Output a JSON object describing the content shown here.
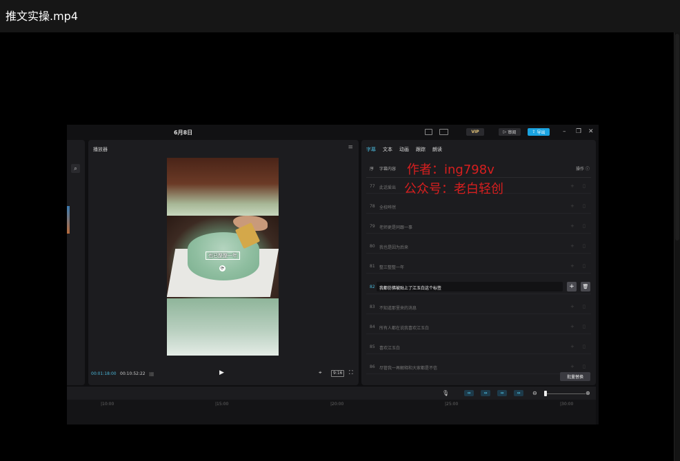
{
  "top_bar": {
    "title": "推文实操.mp4"
  },
  "app": {
    "date": "6月8日",
    "vip_label": "VIP",
    "publish_label": "审阅",
    "export_label": "导出",
    "window_controls": {
      "minimize": "–",
      "maximize": "❐",
      "close": "✕"
    }
  },
  "player": {
    "title": "播放器",
    "menu_icon": "≡",
    "current_time": "00:01:18:00",
    "total_time": "00:10:52:22",
    "ratio_label": "9:16",
    "subtitle_overlay": "也已整整一年",
    "play_icon": "▶"
  },
  "subtitle_panel": {
    "tabs": [
      "字幕",
      "文本",
      "动画",
      "跟踪",
      "朗读"
    ],
    "active_tab": 0,
    "col_index": "序",
    "col_content": "字幕内容",
    "col_actions": "操作 ⓘ",
    "watermark_line1": "作者：ing798v",
    "watermark_line2": "公众号：老白轻创",
    "rows": [
      {
        "num": "77",
        "text": "此话爱出"
      },
      {
        "num": "78",
        "text": "全校哗然"
      },
      {
        "num": "79",
        "text": "老师更是同跟一事"
      },
      {
        "num": "80",
        "text": "我也是因为后来"
      },
      {
        "num": "81",
        "text": "整三整整一年"
      },
      {
        "num": "82",
        "text": "我都仿佛被贴上了江玉白这个标签"
      },
      {
        "num": "83",
        "text": "不知道那里来的消息"
      },
      {
        "num": "84",
        "text": "所有人都在说我喜欢江玉白"
      },
      {
        "num": "85",
        "text": "喜欢江玉白"
      },
      {
        "num": "86",
        "text": "尽管我一再解释和大家都是不信"
      }
    ],
    "active_row": 5,
    "batch_button": "批量替换"
  },
  "timeline": {
    "ticks": [
      "|10:00",
      "|15:00",
      "|20:00",
      "|25:00",
      "|30:00"
    ]
  },
  "colors": {
    "accent": "#4ab6d8",
    "watermark": "#d81f1f",
    "export": "#1aa3e0"
  }
}
